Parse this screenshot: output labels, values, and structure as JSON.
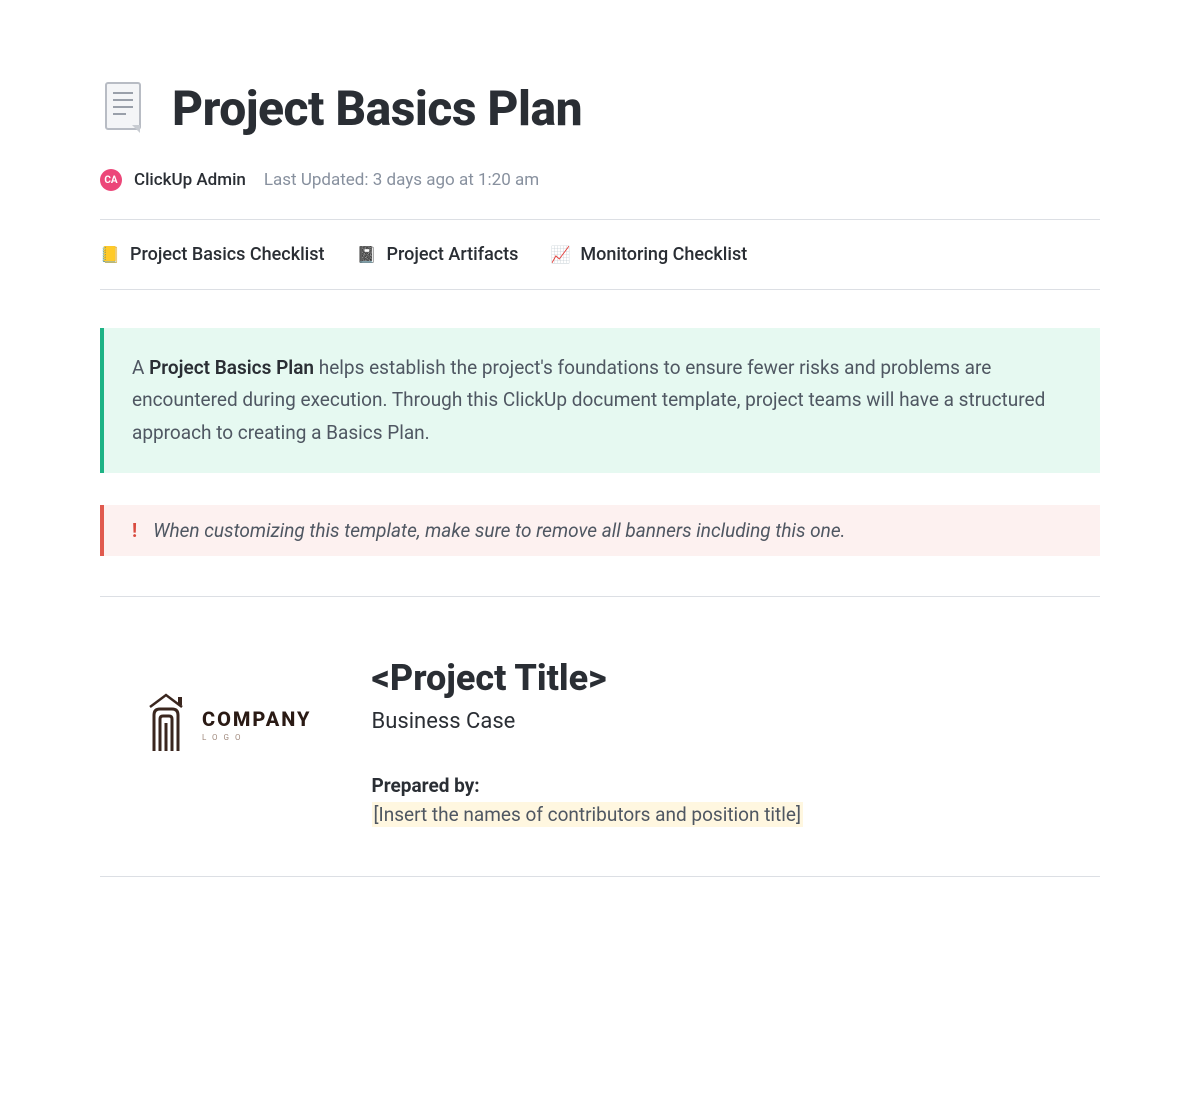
{
  "header": {
    "title": "Project Basics Plan",
    "author_initials": "CA",
    "author": "ClickUp Admin",
    "last_updated": "Last Updated: 3 days ago at 1:20 am"
  },
  "tabs": [
    {
      "icon": "📒",
      "label": "Project Basics Checklist"
    },
    {
      "icon": "📓",
      "label": "Project Artifacts"
    },
    {
      "icon": "📈",
      "label": "Monitoring Checklist"
    }
  ],
  "banners": {
    "green_bold": "Project Basics Plan",
    "green_before": "A ",
    "green_after": " helps establish the project's foundations to ensure fewer risks and problems are encountered during execution. Through this ClickUp document template, project teams will have a structured approach to creating a Basics Plan.",
    "red_icon": "!",
    "red_text": "When customizing this template, make sure to remove all banners including this one."
  },
  "company": {
    "word": "COMPANY",
    "sub": "LOGO"
  },
  "project": {
    "title": "<Project Title>",
    "subtitle": "Business Case",
    "prepared_label": "Prepared by:",
    "prepared_value": "[Insert the names of contributors and position title]"
  }
}
